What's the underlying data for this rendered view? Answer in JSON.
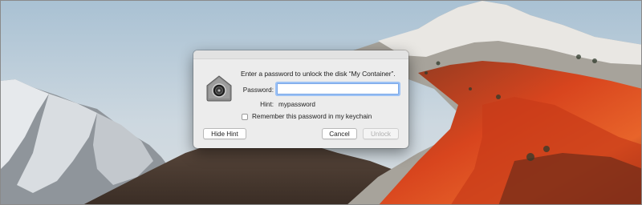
{
  "dialog": {
    "message": "Enter a password to unlock the disk “My Container”.",
    "password_label": "Password:",
    "password_value": "",
    "hint_label": "Hint:",
    "hint_value": "mypassword",
    "remember_label": "Remember this password in my keychain",
    "remember_checked": false,
    "buttons": {
      "hide_hint": "Hide Hint",
      "cancel": "Cancel",
      "unlock": "Unlock"
    },
    "unlock_enabled": false
  },
  "icons": {
    "dialog_icon": "disk-lock-icon"
  },
  "colors": {
    "focus_ring": "#9cc2f5",
    "dialog_background": "#ececec"
  }
}
